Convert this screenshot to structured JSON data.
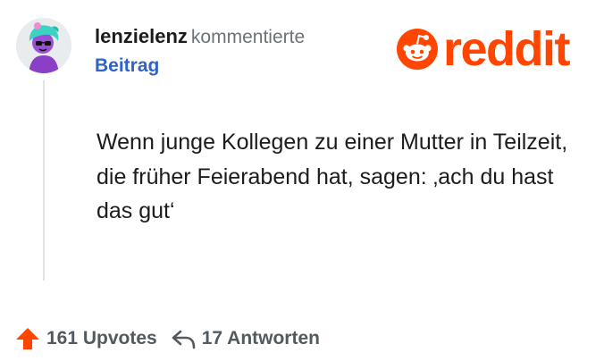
{
  "comment": {
    "username": "lenzielenz",
    "action": "kommentierte",
    "post_link": "Beitrag",
    "text": "Wenn junge Kollegen zu einer Mutter in Teilzeit, die früher Feierabend hat, sagen: ‚ach du hast das gut‘"
  },
  "logo": {
    "word": "reddit",
    "icon": "reddit-snoo-icon"
  },
  "actions": {
    "upvotes": "161 Upvotes",
    "replies": "17 Antworten",
    "upvote_icon": "upvote-arrow-icon",
    "reply_icon": "reply-arrow-icon"
  },
  "colors": {
    "brand": "#ff4500",
    "link": "#2f63c9",
    "text": "#1c1c1c",
    "meta": "#6b7378"
  }
}
